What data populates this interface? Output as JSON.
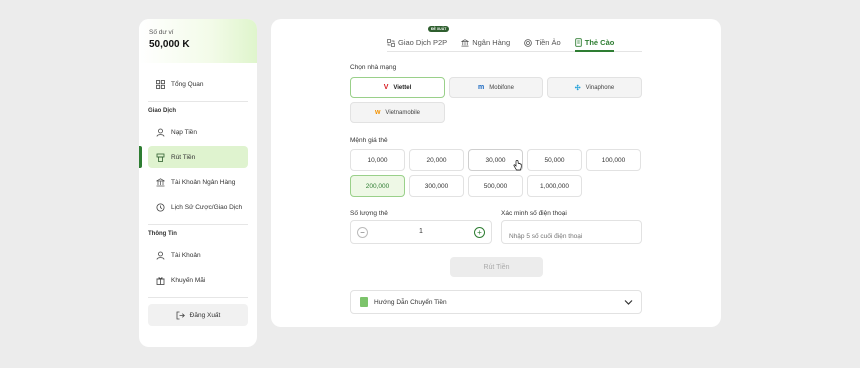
{
  "sidebar": {
    "balance_label": "Số dư ví",
    "balance_value": "50,000 K",
    "items": [
      {
        "label": "Tổng Quan",
        "icon": "grid-icon"
      },
      {
        "label": "Nạp Tiền",
        "icon": "user-icon"
      },
      {
        "label": "Rút Tiền",
        "icon": "withdraw-icon"
      },
      {
        "label": "Tài Khoản Ngân Hàng",
        "icon": "bank-icon"
      },
      {
        "label": "Lịch Sử Cược/Giao Dịch",
        "icon": "history-icon"
      },
      {
        "label": "Tài Khoản",
        "icon": "user-icon"
      },
      {
        "label": "Khuyến Mãi",
        "icon": "gift-icon"
      }
    ],
    "section_transaction": "Giao Dịch",
    "section_info": "Thông Tin",
    "logout_label": "Đăng Xuất"
  },
  "tabs": {
    "badge": "ĐỀ XUẤT",
    "items": [
      {
        "label": "Giao Dịch P2P",
        "icon": "p2p-icon"
      },
      {
        "label": "Ngân Hàng",
        "icon": "bank-icon"
      },
      {
        "label": "Tiền Ảo",
        "icon": "crypto-icon"
      },
      {
        "label": "Thẻ Cào",
        "icon": "card-icon"
      }
    ]
  },
  "network": {
    "label": "Chọn nhà mạng",
    "options": [
      "Viettel",
      "Mobifone",
      "Vinaphone",
      "Vietnamobile"
    ],
    "selected": "Viettel"
  },
  "denomination": {
    "label": "Mệnh giá thẻ",
    "options": [
      "10,000",
      "20,000",
      "30,000",
      "50,000",
      "100,000",
      "200,000",
      "300,000",
      "500,000",
      "1,000,000"
    ],
    "selected": "200,000"
  },
  "quantity": {
    "label": "Số lượng thẻ",
    "value": "1",
    "minus": "−",
    "plus": "+"
  },
  "phone": {
    "label": "Xác minh số điện thoại",
    "placeholder": "Nhập 5 số cuối điện thoại"
  },
  "submit_label": "Rút Tiền",
  "guide_label": "Hướng Dẫn Chuyển Tiền",
  "colors": {
    "accent": "#2e7d32",
    "accent_light": "#dff3cf",
    "background": "#ececec"
  }
}
